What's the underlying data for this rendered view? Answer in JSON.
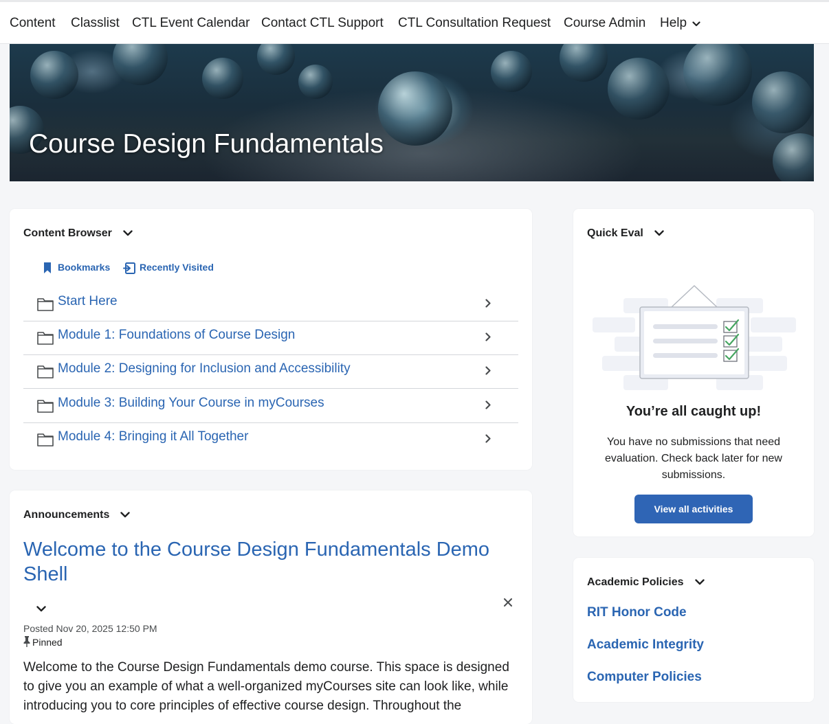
{
  "nav": {
    "items": [
      "Content",
      "Classlist",
      "CTL Event Calendar",
      "Contact CTL Support",
      "CTL Consultation Request",
      "Course Admin",
      "Help"
    ]
  },
  "banner": {
    "title": "Course Design Fundamentals"
  },
  "content_browser": {
    "header": "Content Browser",
    "tabs": [
      "Bookmarks",
      "Recently Visited"
    ],
    "modules": [
      "Start Here",
      "Module 1: Foundations of Course Design",
      "Module 2: Designing for Inclusion and Accessibility",
      "Module 3: Building Your Course in myCourses",
      "Module 4: Bringing it All Together"
    ]
  },
  "announcements": {
    "header": "Announcements",
    "title": "Welcome to the Course Design Fundamentals Demo Shell",
    "posted": "Posted Nov 20, 2025 12:50 PM",
    "pinned": "Pinned",
    "body": "Welcome to the Course Design Fundamentals demo course. This space is designed to give you an example of what a well-organized myCourses site can look like, while introducing you to core principles of effective course design. Throughout the"
  },
  "quick_eval": {
    "header": "Quick Eval",
    "heading": "You’re all caught up!",
    "message": "You have no submissions that need evaluation. Check back later for new submissions.",
    "button": "View all activities"
  },
  "academic_policies": {
    "header": "Academic Policies",
    "links": [
      "RIT Honor Code",
      "Academic Integrity",
      "Computer Policies"
    ]
  },
  "colors": {
    "link": "#2a65b2",
    "button": "#2f65b5",
    "background": "#f5f6f8"
  }
}
